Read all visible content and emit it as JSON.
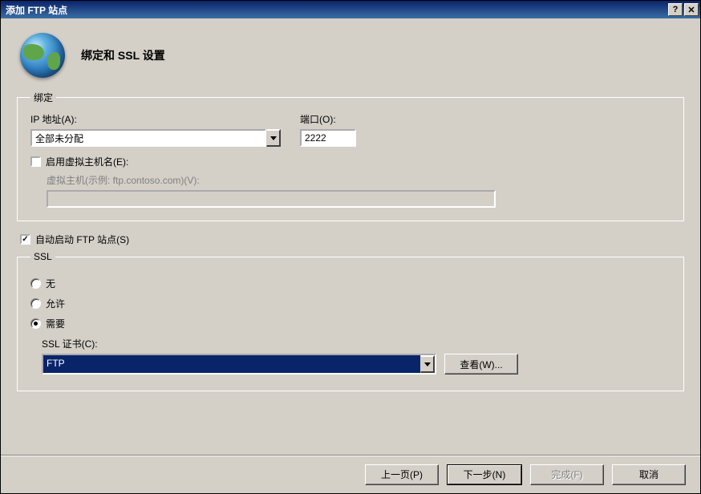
{
  "window": {
    "title": "添加 FTP 站点"
  },
  "header": {
    "title": "绑定和 SSL 设置"
  },
  "binding": {
    "legend": "绑定",
    "ip_label": "IP 地址(A):",
    "ip_value": "全部未分配",
    "port_label": "端口(O):",
    "port_value": "2222",
    "enable_vhost_label": "启用虚拟主机名(E):",
    "enable_vhost_checked": false,
    "vhost_label": "虚拟主机(示例: ftp.contoso.com)(V):",
    "vhost_value": ""
  },
  "auto_start": {
    "label": "自动启动 FTP 站点(S)",
    "checked": true
  },
  "ssl": {
    "legend": "SSL",
    "options": {
      "none": "无",
      "allow": "允许",
      "require": "需要"
    },
    "selected": "require",
    "cert_label": "SSL 证书(C):",
    "cert_value": "FTP",
    "view_button": "查看(W)..."
  },
  "footer": {
    "prev": "上一页(P)",
    "next": "下一步(N)",
    "finish": "完成(F)",
    "cancel": "取消"
  }
}
